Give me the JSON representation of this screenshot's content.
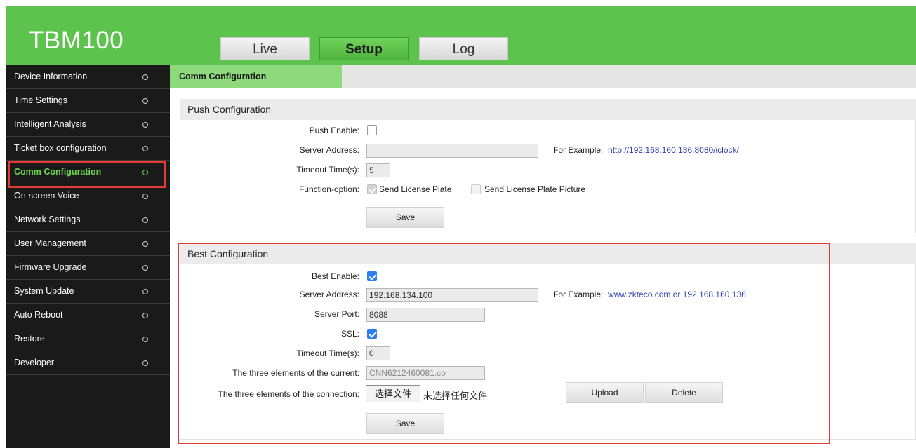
{
  "app": {
    "logo": "TBM100"
  },
  "tabs": [
    {
      "label": "Live",
      "active": false
    },
    {
      "label": "Setup",
      "active": true
    },
    {
      "label": "Log",
      "active": false
    }
  ],
  "sidebar": {
    "items": [
      {
        "label": "Device Information"
      },
      {
        "label": "Time Settings"
      },
      {
        "label": "Intelligent Analysis"
      },
      {
        "label": "Ticket box configuration"
      },
      {
        "label": "Comm Configuration",
        "active": true
      },
      {
        "label": "On-screen Voice"
      },
      {
        "label": "Network Settings"
      },
      {
        "label": "User Management"
      },
      {
        "label": "Firmware Upgrade"
      },
      {
        "label": "System Update"
      },
      {
        "label": "Auto Reboot"
      },
      {
        "label": "Restore"
      },
      {
        "label": "Developer"
      }
    ]
  },
  "breadcrumb": "Comm Configuration",
  "push": {
    "title": "Push Configuration",
    "enable_label": "Push Enable:",
    "enable_checked": false,
    "server_label": "Server Address:",
    "server_value": "",
    "example_label": "For Example:",
    "example_value": "http://192.168.160.136:8080/iclock/",
    "timeout_label": "Timeout Time(s):",
    "timeout_value": "5",
    "function_label": "Function-option:",
    "opt_plate_label": "Send License Plate",
    "opt_plate_checked": true,
    "opt_picture_label": "Send License Plate Picture",
    "opt_picture_checked": false,
    "save_label": "Save"
  },
  "best": {
    "title": "Best Configuration",
    "enable_label": "Best Enable:",
    "enable_checked": true,
    "server_label": "Server Address:",
    "server_value": "192.168.134.100",
    "example_label": "For Example:",
    "example_value": "www.zkteco.com or 192.168.160.136",
    "port_label": "Server Port:",
    "port_value": "8088",
    "ssl_label": "SSL:",
    "ssl_checked": true,
    "timeout_label": "Timeout Time(s):",
    "timeout_value": "0",
    "current_label": "The three elements of the current:",
    "current_value": "CNN6212460081.co",
    "connection_label": "The three elements of the connection:",
    "file_button_label": "选择文件",
    "file_status": "未选择任何文件",
    "upload_label": "Upload",
    "delete_label": "Delete",
    "save_label": "Save"
  },
  "colors": {
    "header_green": "#5cc34c",
    "active_green": "#6bd64f",
    "highlight_red": "#e53935",
    "link_blue": "#2f3fb0"
  }
}
